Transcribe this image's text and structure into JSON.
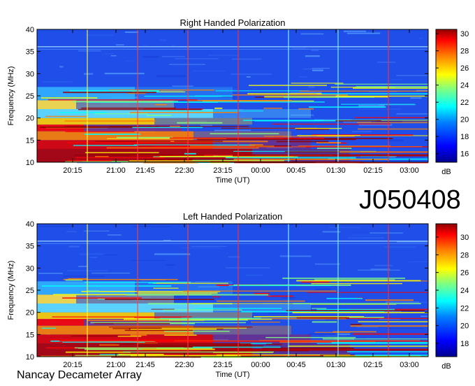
{
  "page_label": "J050408",
  "footer": "Nancay Decameter Array",
  "colors": {
    "scale": [
      "#00008f",
      "#0000ff",
      "#0080ff",
      "#00ffff",
      "#80ff80",
      "#ffff00",
      "#ff8000",
      "#ff0000",
      "#8f0000"
    ]
  },
  "chart_data": [
    {
      "type": "heatmap",
      "title": "Right Handed Polarization",
      "xlabel": "Time (UT)",
      "ylabel": "Frequency (MHz)",
      "x_ticks": [
        "20:15",
        "21:00",
        "21:45",
        "22:30",
        "23:15",
        "00:00",
        "00:45",
        "01:30",
        "02:15",
        "03:00"
      ],
      "y_ticks": [
        10,
        15,
        20,
        25,
        30,
        35,
        40
      ],
      "ylim": [
        10,
        40
      ],
      "colorbar": {
        "label": "dB",
        "ticks": [
          16,
          18,
          20,
          22,
          24,
          26,
          28,
          30
        ],
        "range": [
          15,
          30.5
        ]
      }
    },
    {
      "type": "heatmap",
      "title": "Left Handed Polarization",
      "xlabel": "Time (UT)",
      "ylabel": "Frequency (MHz)",
      "x_ticks": [
        "20:15",
        "21:00",
        "21:45",
        "22:30",
        "23:15",
        "00:00",
        "00:45",
        "01:30",
        "02:15",
        "03:00"
      ],
      "y_ticks": [
        10,
        15,
        20,
        25,
        30,
        35,
        40
      ],
      "ylim": [
        10,
        40
      ],
      "colorbar": {
        "label": "dB",
        "ticks": [
          18,
          20,
          22,
          24,
          26,
          28,
          30
        ],
        "range": [
          16.5,
          31.5
        ]
      }
    }
  ]
}
